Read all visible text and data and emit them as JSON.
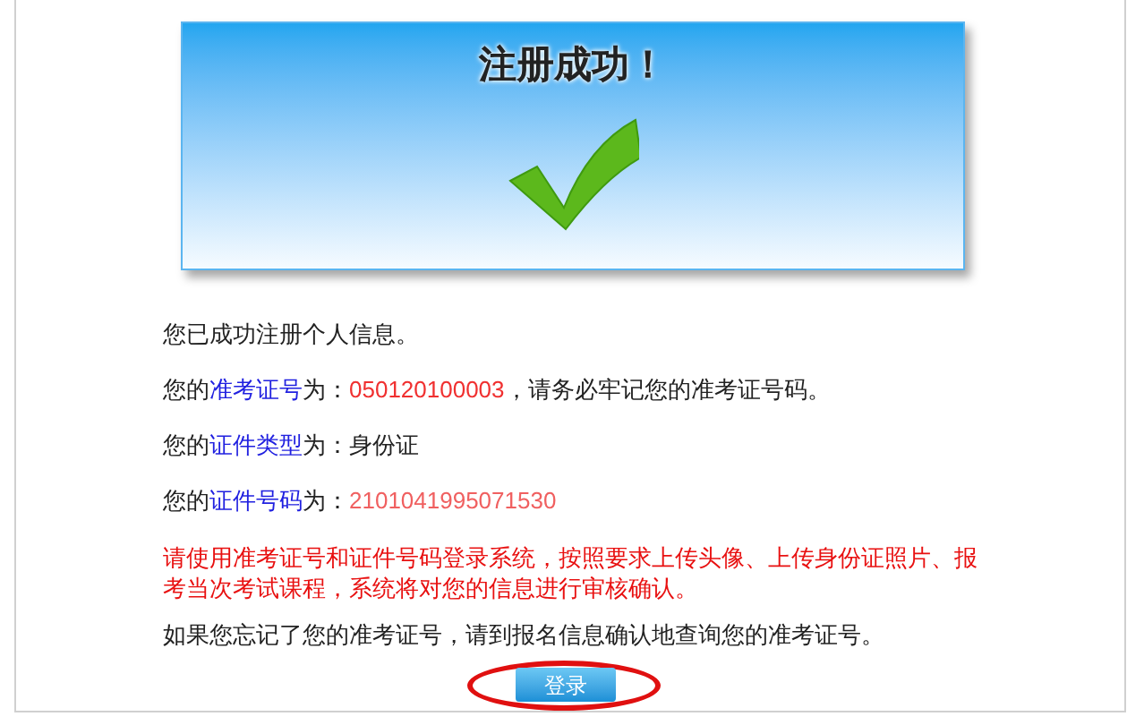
{
  "banner": {
    "title": "注册成功！"
  },
  "lines": [
    {
      "segments": [
        {
          "kind": "text",
          "text": "您已成功注册个人信息。"
        }
      ]
    },
    {
      "segments": [
        {
          "kind": "text",
          "text": "您的"
        },
        {
          "kind": "term",
          "text": "准考证号"
        },
        {
          "kind": "text",
          "text": "为："
        },
        {
          "kind": "value",
          "text": "050120100003"
        },
        {
          "kind": "text",
          "text": "，请务必牢记您的准考证号码。"
        }
      ]
    },
    {
      "segments": [
        {
          "kind": "text",
          "text": "您的"
        },
        {
          "kind": "term",
          "text": "证件类型"
        },
        {
          "kind": "text",
          "text": "为：身份证"
        }
      ]
    },
    {
      "segments": [
        {
          "kind": "text",
          "text": "您的"
        },
        {
          "kind": "term",
          "text": "证件号码"
        },
        {
          "kind": "text",
          "text": "为："
        },
        {
          "kind": "masked",
          "text": "2101041995071530"
        }
      ]
    }
  ],
  "notice": "请使用准考证号和证件号码登录系统，按照要求上传头像、上传身份证照片、报考当次考试课程，系统将对您的信息进行审核确认。",
  "footer_text": "如果您忘记了您的准考证号，请到报名信息确认地查询您的准考证号。",
  "login_button": "登录"
}
